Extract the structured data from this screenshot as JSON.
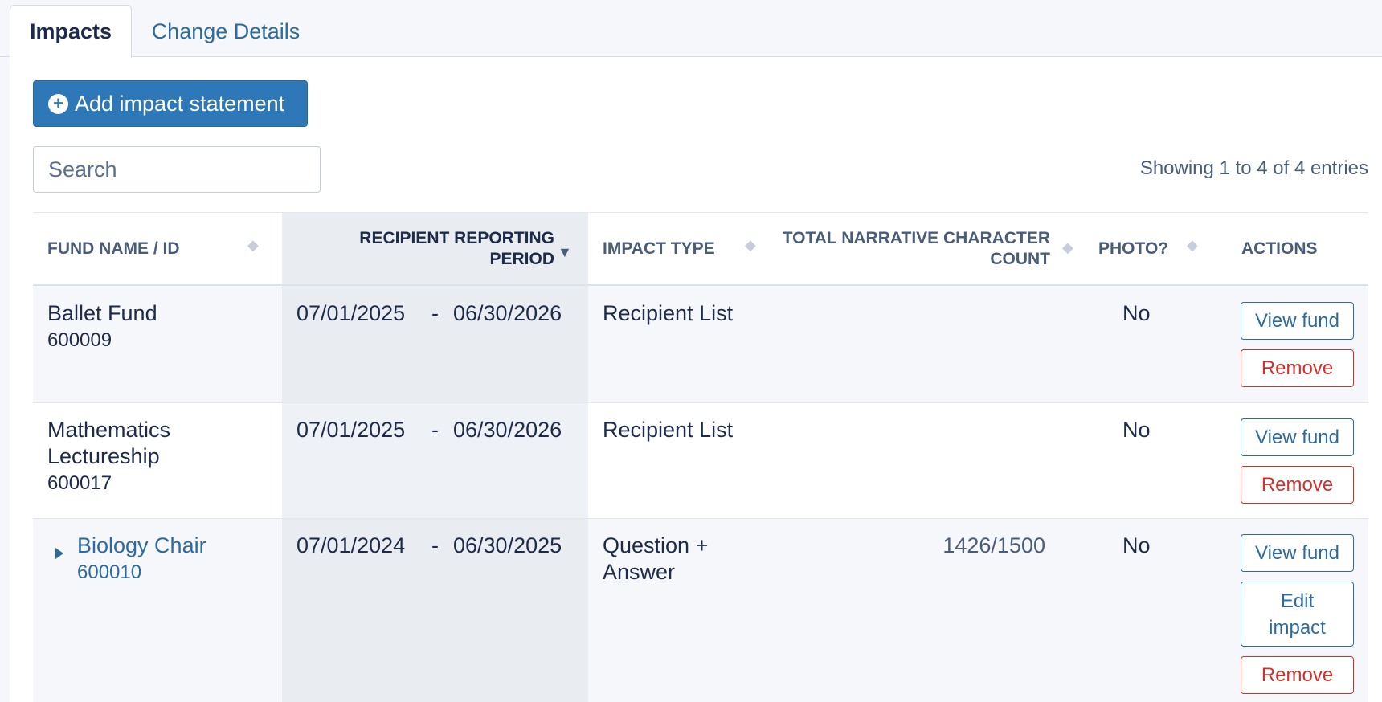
{
  "tabs": [
    {
      "label": "Impacts",
      "active": true
    },
    {
      "label": "Change Details",
      "active": false
    }
  ],
  "toolbar": {
    "add_label": "Add impact statement",
    "search_placeholder": "Search",
    "showing_text": "Showing 1 to 4 of 4 entries"
  },
  "columns": [
    {
      "label": "FUND NAME / ID"
    },
    {
      "label": "RECIPIENT REPORTING PERIOD"
    },
    {
      "label": "IMPACT TYPE"
    },
    {
      "label": "TOTAL NARRATIVE CHARACTER COUNT"
    },
    {
      "label": "PHOTO?"
    },
    {
      "label": "ACTIONS"
    }
  ],
  "rows": [
    {
      "fund_name": "Ballet Fund",
      "fund_id": "600009",
      "period_start": "07/01/2025",
      "period_sep": "-",
      "period_end": "06/30/2026",
      "impact_type": "Recipient List",
      "char_count": "",
      "photo": "No",
      "actions": {
        "view": "View fund",
        "remove": "Remove"
      }
    },
    {
      "fund_name": "Mathematics Lectureship",
      "fund_id": "600017",
      "period_start": "07/01/2025",
      "period_sep": "-",
      "period_end": "06/30/2026",
      "impact_type": "Recipient List",
      "char_count": "",
      "photo": "No",
      "actions": {
        "view": "View fund",
        "remove": "Remove"
      }
    },
    {
      "fund_name": "Biology Chair",
      "fund_id": "600010",
      "period_start": "07/01/2024",
      "period_sep": "-",
      "period_end": "06/30/2025",
      "impact_type": "Question + Answer",
      "char_count": "1426/1500",
      "photo": "No",
      "actions": {
        "view": "View fund",
        "edit": "Edit impact",
        "remove": "Remove"
      }
    }
  ],
  "icons": {
    "plus": "plus-circle-icon",
    "sort": "sort-icon",
    "expand": "caret-right-icon"
  },
  "colors": {
    "primary": "#2e78b7",
    "link": "#2d6a9f",
    "danger": "#d0312d",
    "text": "#1c2b4a",
    "muted": "#4a5d78"
  }
}
